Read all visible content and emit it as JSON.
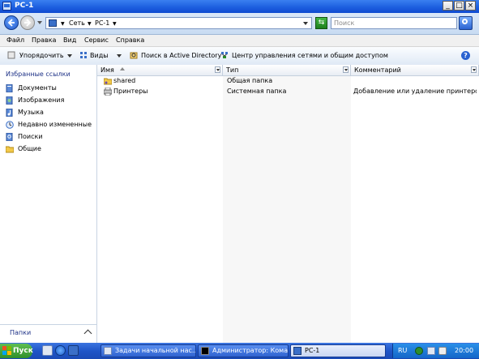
{
  "window": {
    "title": "PC-1"
  },
  "address": {
    "crumbs": [
      "Сеть",
      "PC-1"
    ],
    "search_placeholder": "Поиск"
  },
  "menu": [
    "Файл",
    "Правка",
    "Вид",
    "Сервис",
    "Справка"
  ],
  "toolbar": {
    "organize": "Упорядочить",
    "views": "Виды",
    "search_ad": "Поиск в Active Directory",
    "network_center": "Центр управления сетями и общим доступом"
  },
  "sidebar": {
    "title": "Избранные ссылки",
    "items": [
      {
        "label": "Документы",
        "icon": "documents-icon"
      },
      {
        "label": "Изображения",
        "icon": "pictures-icon"
      },
      {
        "label": "Музыка",
        "icon": "music-icon"
      },
      {
        "label": "Недавно измененные",
        "icon": "recent-icon"
      },
      {
        "label": "Поиски",
        "icon": "searches-icon"
      },
      {
        "label": "Общие",
        "icon": "public-icon"
      }
    ],
    "folders_label": "Папки"
  },
  "list": {
    "columns": [
      "Имя",
      "Тип",
      "Комментарий"
    ],
    "rows": [
      {
        "name": "shared",
        "type": "Общая папка",
        "comment": "",
        "icon": "shared-folder-icon"
      },
      {
        "name": "Принтеры",
        "type": "Системная папка",
        "comment": "Добавление или удаление принтеро...",
        "icon": "printers-icon"
      }
    ]
  },
  "taskbar": {
    "start": "Пуск",
    "tasks": [
      {
        "label": "Задачи начальной нас...",
        "active": false
      },
      {
        "label": "Администратор: Кома...",
        "active": false
      },
      {
        "label": "PC-1",
        "active": true
      }
    ],
    "lang": "RU",
    "time": "20:00"
  },
  "colors": {
    "title_bar": "#1d5fe0",
    "taskbar": "#1f55c8",
    "start_button": "#2f8f2b",
    "link_text": "#1e3287"
  }
}
